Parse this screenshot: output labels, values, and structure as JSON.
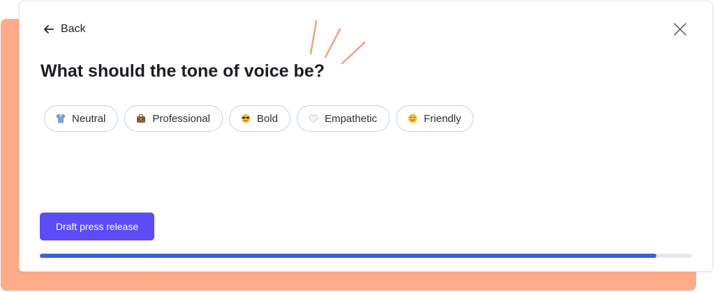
{
  "header": {
    "back_label": "Back"
  },
  "question": {
    "title": "What should the tone of voice be?"
  },
  "tones": [
    {
      "label": "Neutral",
      "icon": "shirt-icon"
    },
    {
      "label": "Professional",
      "icon": "briefcase-icon"
    },
    {
      "label": "Bold",
      "icon": "sunglasses-face-icon"
    },
    {
      "label": "Empathetic",
      "icon": "white-heart-icon"
    },
    {
      "label": "Friendly",
      "icon": "smiling-face-icon"
    }
  ],
  "actions": {
    "draft_label": "Draft press release"
  },
  "progress": {
    "fraction": 0.945
  },
  "colors": {
    "backdrop": "#FFAA88",
    "accent_button": "#5B4CF5",
    "progress_fill": "#3B5FDB",
    "progress_track": "#E6E7EC",
    "chip_border": "#BFD2EC",
    "spark": "#F5A07E"
  }
}
